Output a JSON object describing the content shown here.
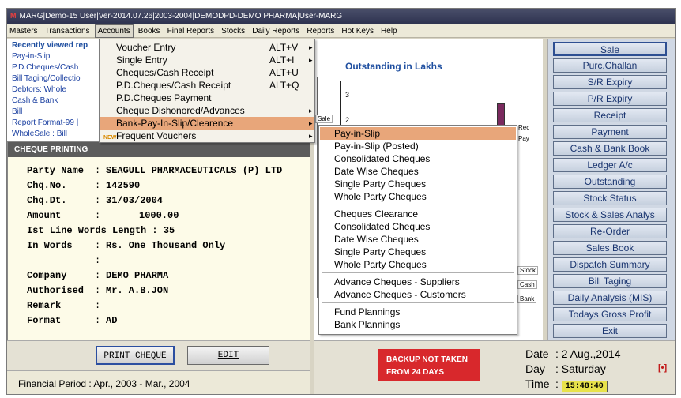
{
  "window": {
    "title": "MARG|Demo-15 User|Ver-2014.07.26|2003-2004|DEMODPD-DEMO PHARMA|User-MARG",
    "logo": "M"
  },
  "menubar": [
    "Masters",
    "Transactions",
    "Accounts",
    "Books",
    "Final Reports",
    "Stocks",
    "Daily Reports",
    "Reports",
    "Hot Keys",
    "Help"
  ],
  "recent": {
    "header": "Recently viewed rep",
    "items": [
      "Pay-in-Slip",
      "P.D.Cheques/Cash",
      "Bill Taging/Collectio",
      "Debtors: Whole",
      "Cash & Bank",
      "Bill",
      "Report Format-99 |",
      "WholeSale : Bill"
    ]
  },
  "accounts_menu": {
    "items": [
      {
        "label": "Voucher Entry",
        "shortcut": "ALT+V",
        "arrow": "▸"
      },
      {
        "label": "Single Entry",
        "shortcut": "ALT+I",
        "arrow": "▸"
      },
      {
        "label": "Cheques/Cash Receipt",
        "shortcut": "ALT+U",
        "arrow": ""
      },
      {
        "label": "P.D.Cheques/Cash Receipt",
        "shortcut": "ALT+Q",
        "arrow": ""
      },
      {
        "label": "P.D.Cheques Payment",
        "shortcut": "",
        "arrow": ""
      },
      {
        "label": "Cheque Dishonored/Advances",
        "shortcut": "",
        "arrow": "▸"
      },
      {
        "label": "Bank-Pay-In-Slip/Clearence",
        "shortcut": "",
        "arrow": "▸"
      },
      {
        "label": "Frequent Vouchers",
        "shortcut": "",
        "arrow": "▸"
      }
    ],
    "new_badge": "NEW"
  },
  "submenu": {
    "groups": [
      [
        "Pay-in-Slip",
        "Pay-in-Slip (Posted)",
        "Consolidated Cheques",
        "Date Wise Cheques",
        "Single Party Cheques",
        "Whole Party Cheques"
      ],
      [
        "Cheques Clearance",
        "Consolidated Cheques",
        "Date Wise Cheques",
        "Single Party Cheques",
        "Whole Party Cheques"
      ],
      [
        "Advance Cheques - Suppliers",
        "Advance Cheques - Customers"
      ],
      [
        "Fund Plannings",
        "Bank Plannings"
      ]
    ]
  },
  "cheque": {
    "header": "CHEQUE PRINTING",
    "rows": [
      {
        "label": "Party Name",
        "value": "SEAGULL PHARMACEUTICALS (P) LTD"
      },
      {
        "label": "Chq.No.",
        "value": "142590"
      },
      {
        "label": "Chq.Dt.",
        "value": "31/03/2004"
      },
      {
        "label": "Amount",
        "value": "1000.00"
      }
    ],
    "words_length": "Ist Line Words Length : 35",
    "in_words_label": "In Words",
    "in_words_value": "Rs. One Thousand Only",
    "rows2": [
      {
        "label": "Company",
        "value": "DEMO PHARMA"
      },
      {
        "label": "Authorised",
        "value": "Mr. A.B.JON"
      },
      {
        "label": "Remark",
        "value": ""
      },
      {
        "label": "Format",
        "value": "AD"
      }
    ],
    "colon": ":",
    "print_button": "PRINT CHEQUE",
    "edit_button": "EDIT"
  },
  "financial_period": "Financial Period : Apr., 2003 - Mar., 2004",
  "chart": {
    "title": "Outstanding in Lakhs",
    "ticks": [
      "3",
      "2"
    ],
    "legend": [
      "Rec",
      "Pay"
    ],
    "tags": [
      "Sale",
      "Stock",
      "Cash",
      "Bank"
    ],
    "colors": {
      "bar": "#7a2a5e",
      "rec": "#6a4a8a",
      "pay": "#7a2a5e"
    }
  },
  "chart_data": {
    "type": "bar",
    "title": "Outstanding in Lakhs",
    "categories": [
      "Sale"
    ],
    "series": [
      {
        "name": "Rec",
        "values": [
          2.2
        ]
      }
    ],
    "ylim": [
      0,
      3.3
    ]
  },
  "sidebar": [
    "Sale",
    "Purc.Challan",
    "S/R Expiry",
    "P/R Expiry",
    "Receipt",
    "Payment",
    "Cash & Bank Book",
    "Ledger A/c",
    "Outstanding",
    "Stock Status",
    "Stock & Sales Analys",
    "Re-Order",
    "Sales Book",
    "Dispatch Summary",
    "Bill Taging",
    "Daily Analysis (MIS)",
    "Todays Gross Profit",
    "Exit"
  ],
  "status": {
    "backup_line1": "BACKUP NOT TAKEN",
    "backup_line2": "FROM 24 DAYS",
    "date_label": "Date",
    "date_value": "2 Aug.,2014",
    "day_label": "Day",
    "day_value": "Saturday",
    "time_label": "Time",
    "time_value": "15:48:40",
    "indicator": "[•]"
  }
}
